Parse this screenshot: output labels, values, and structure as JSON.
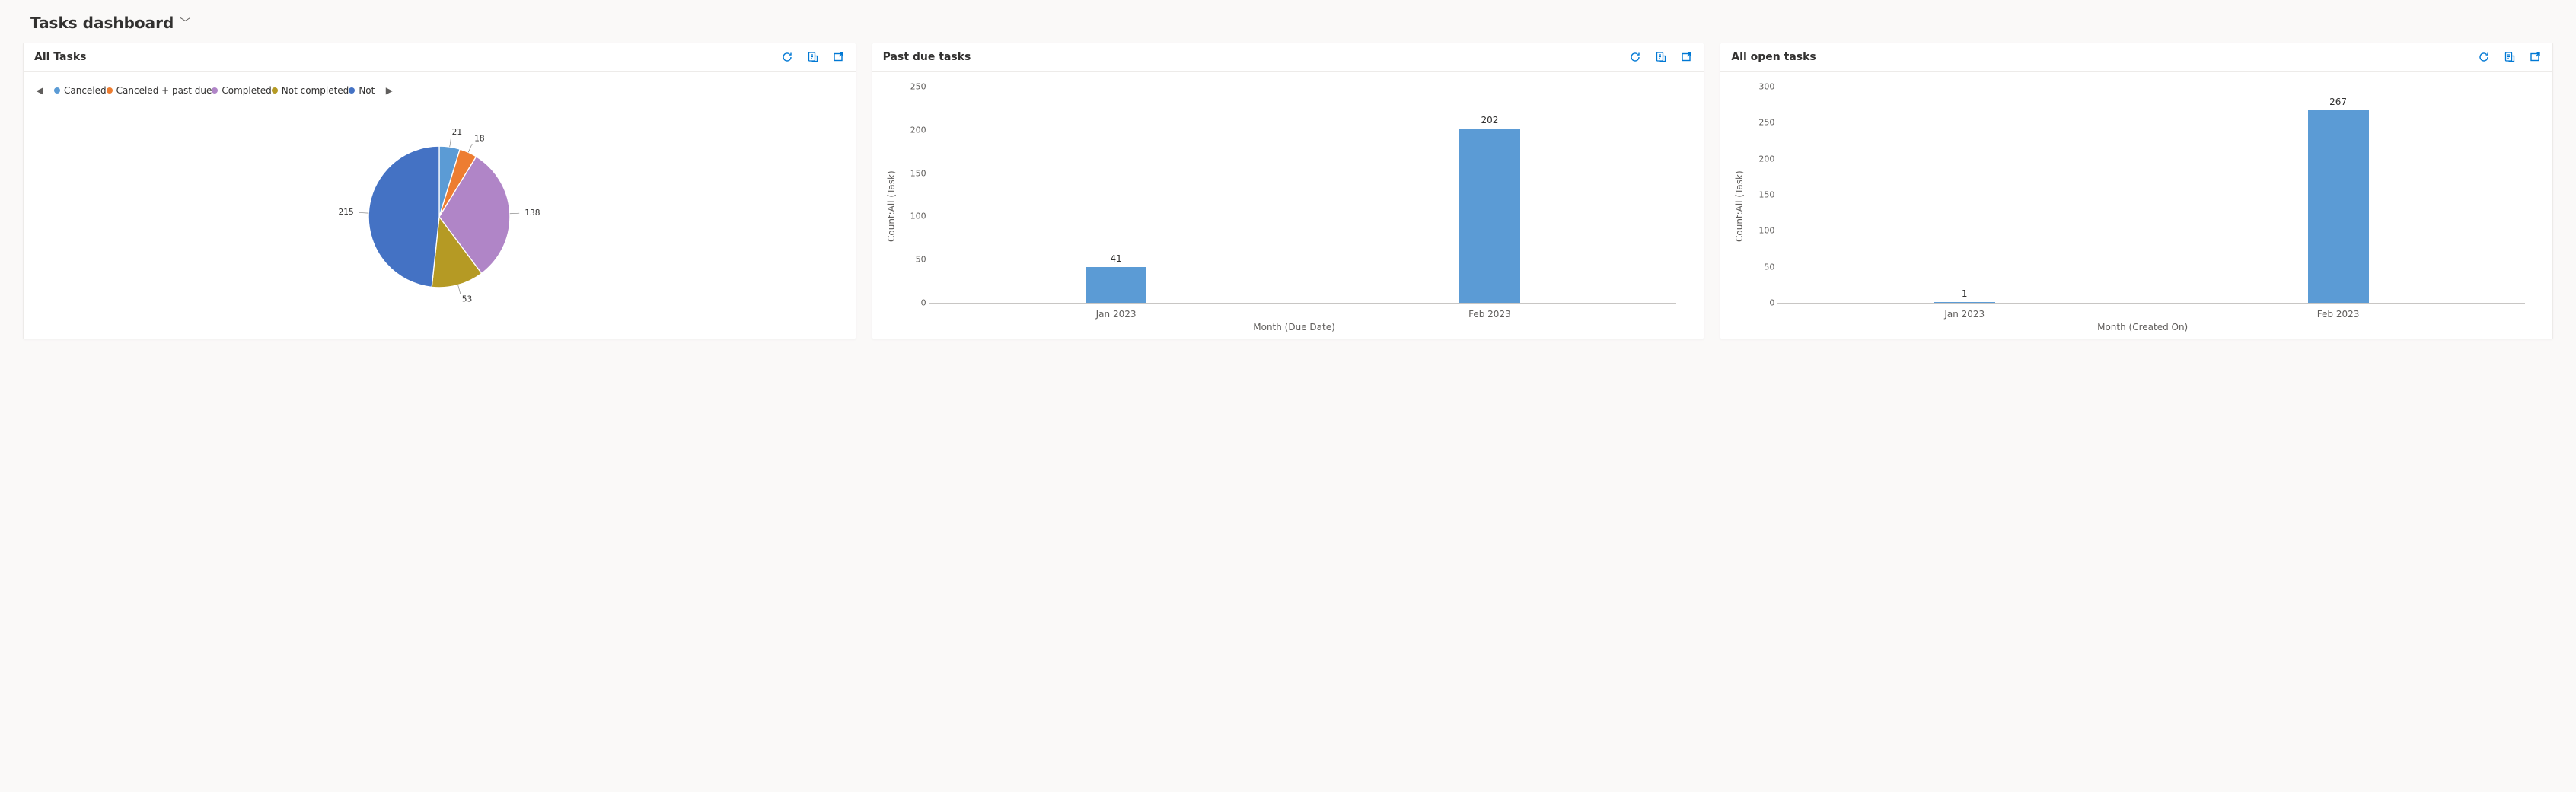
{
  "header": {
    "title": "Tasks dashboard"
  },
  "cards": {
    "allTasks": {
      "title": "All Tasks",
      "legendTruncatedLast": "Not",
      "yAxisLabel": "",
      "xAxisLabel": ""
    },
    "pastDue": {
      "title": "Past due tasks",
      "yAxisLabel": "Count:All (Task)",
      "xAxisLabel": "Month (Due Date)"
    },
    "openTasks": {
      "title": "All open tasks",
      "yAxisLabel": "Count:All (Task)",
      "xAxisLabel": "Month (Created On)"
    }
  },
  "chart_data": [
    {
      "id": "allTasks",
      "type": "pie",
      "title": "All Tasks",
      "series": [
        {
          "name": "Canceled",
          "value": 21,
          "color": "#5b9bd5"
        },
        {
          "name": "Canceled + past due",
          "value": 18,
          "color": "#ed7d31"
        },
        {
          "name": "Completed",
          "value": 138,
          "color": "#b085c7"
        },
        {
          "name": "Not completed",
          "value": 53,
          "color": "#b59a24"
        },
        {
          "name": "Not",
          "value": 215,
          "color": "#4472c4"
        }
      ],
      "legend_position": "top",
      "data_labels": [
        21,
        18,
        138,
        53,
        215
      ]
    },
    {
      "id": "pastDue",
      "type": "bar",
      "title": "Past due tasks",
      "categories": [
        "Jan 2023",
        "Feb 2023"
      ],
      "values": [
        41,
        202
      ],
      "ylabel": "Count:All (Task)",
      "xlabel": "Month (Due Date)",
      "ylim": [
        0,
        250
      ],
      "y_ticks": [
        0,
        50,
        100,
        150,
        200,
        250
      ],
      "bar_color": "#5b9bd5"
    },
    {
      "id": "openTasks",
      "type": "bar",
      "title": "All open tasks",
      "categories": [
        "Jan 2023",
        "Feb 2023"
      ],
      "values": [
        1,
        267
      ],
      "ylabel": "Count:All (Task)",
      "xlabel": "Month (Created On)",
      "ylim": [
        0,
        300
      ],
      "y_ticks": [
        0,
        50,
        100,
        150,
        200,
        250,
        300
      ],
      "bar_color": "#5b9bd5"
    }
  ]
}
